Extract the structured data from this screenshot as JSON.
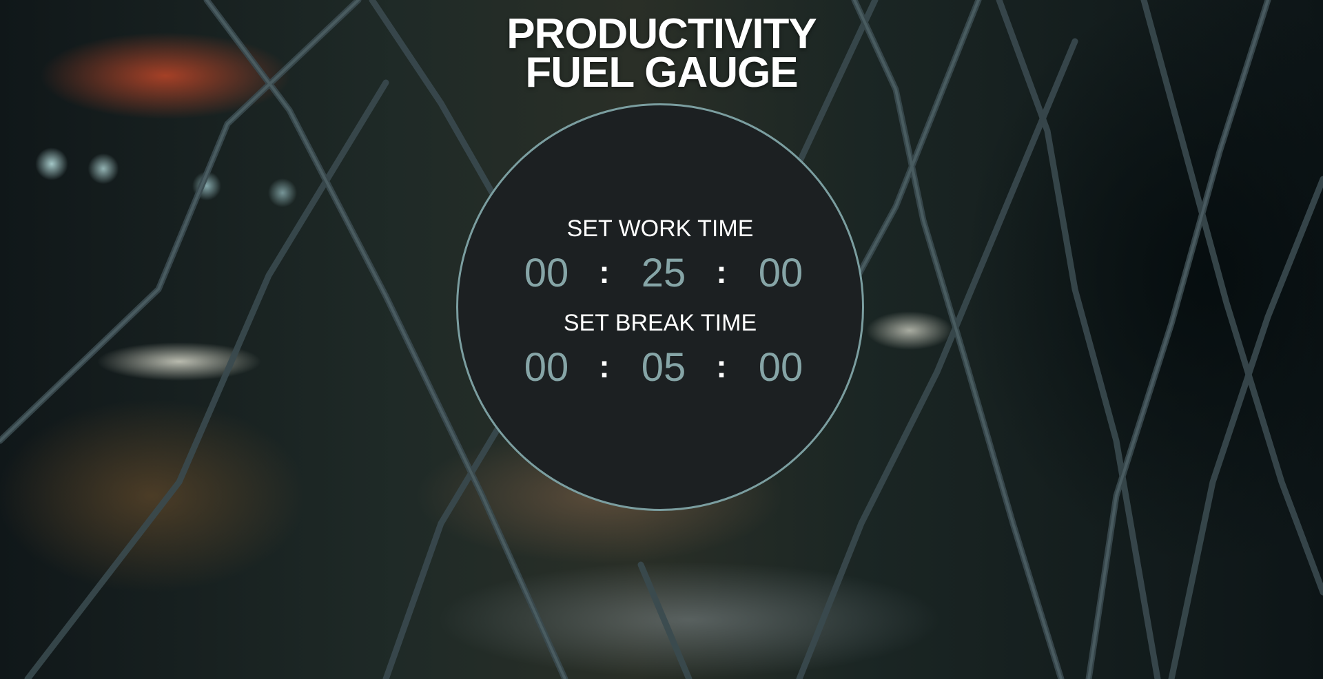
{
  "page": {
    "title_line1": "PRODUCTIVITY",
    "title_line2": "FUEL GAUGE"
  },
  "work": {
    "label": "SET WORK TIME",
    "hours": "00",
    "minutes": "25",
    "seconds": "00"
  },
  "break": {
    "label": "SET BREAK TIME",
    "hours": "00",
    "minutes": "05",
    "seconds": "00"
  },
  "separator": ":",
  "colors": {
    "gauge_face": "#1c2022",
    "gauge_border": "#7b9ea0",
    "digit_color": "#86a5a7",
    "text_color": "#ffffff"
  },
  "background": {
    "description_icon": "chain-link-fence-photo"
  }
}
